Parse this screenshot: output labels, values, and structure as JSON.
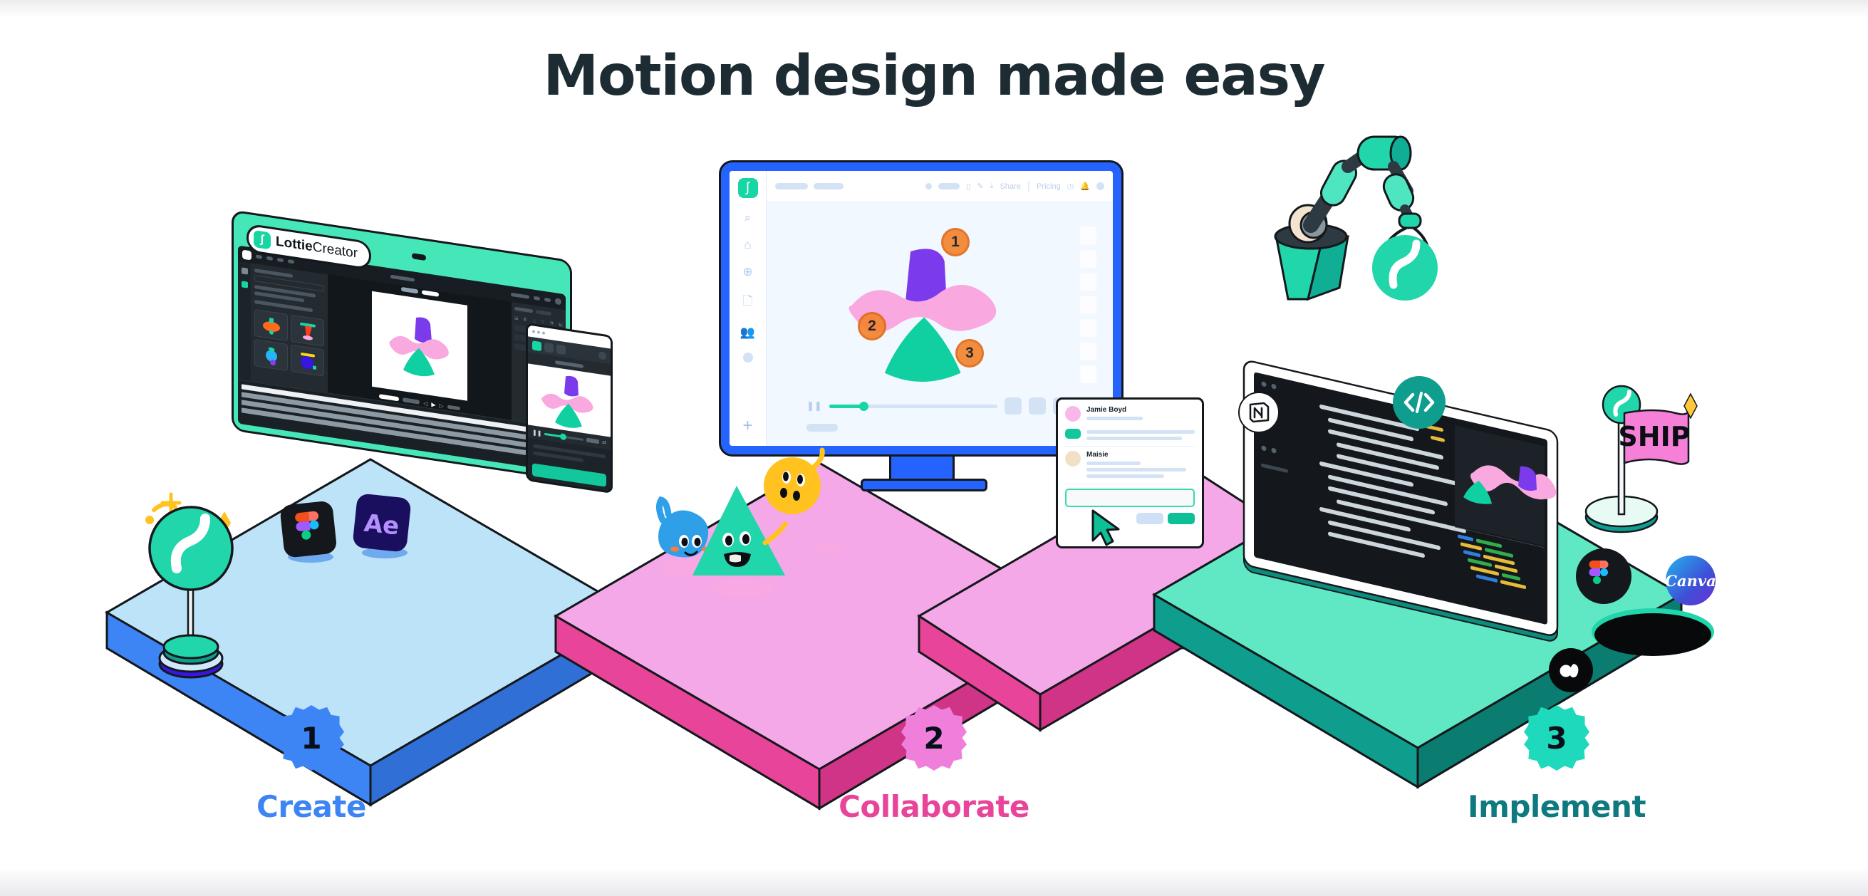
{
  "page": {
    "title": "Motion design made easy",
    "background": "#ffffff"
  },
  "steps": [
    {
      "number": "1",
      "label": "Create",
      "badge_color": "#3d85f5",
      "label_color": "#3d85f5",
      "number_color": "#07101a"
    },
    {
      "number": "2",
      "label": "Collaborate",
      "badge_color": "#f07fdc",
      "label_color": "#e8459a",
      "number_color": "#07101a"
    },
    {
      "number": "3",
      "label": "Implement",
      "badge_color": "#1ed9bc",
      "label_color": "#0e7a80",
      "number_color": "#07101a"
    }
  ],
  "platforms": [
    {
      "name": "create-platform",
      "top_color": "#bde3f8",
      "side_color": "#3d85f5",
      "side_dark": "#2f6fd6"
    },
    {
      "name": "collaborate-platform",
      "top_color": "#f4a8e8",
      "side_color": "#e8459a",
      "side_dark": "#cf3486"
    },
    {
      "name": "implement-platform",
      "top_color": "#5fe8c3",
      "side_color": "#0f9e8e",
      "side_dark": "#0b7c70"
    }
  ],
  "laptop": {
    "name": "lottiecreator-laptop",
    "brand_bold": "Lottie",
    "brand_light": "Creator",
    "shell_color": "#45e6b8",
    "screen_bg": "#1d2429",
    "asset_thumbs": [
      "orange-mushroom",
      "red-swing",
      "blue-balloon",
      "purple-circle"
    ]
  },
  "phone": {
    "name": "mobile-preview",
    "cta_color": "#12c79b"
  },
  "monitor": {
    "name": "lottie-web-app-monitor",
    "bezel_color": "#2563ff",
    "toolbar": {
      "share_label": "Share",
      "pricing_label": "Pricing"
    },
    "sidebar_icons": [
      "search-icon",
      "home-icon",
      "globe-icon",
      "file-icon",
      "people-icon",
      "avatar-icon",
      "plus-icon"
    ],
    "annotations": [
      {
        "number": "1",
        "color": "#f3842f"
      },
      {
        "number": "2",
        "color": "#f3842f"
      },
      {
        "number": "3",
        "color": "#f3842f"
      }
    ],
    "playbar": {
      "progress_percent": 20
    }
  },
  "comment_card": {
    "name": "collaboration-comment-card",
    "comments": [
      {
        "author": "Jamie Boyd",
        "avatar_color": "#f9b8ea"
      },
      {
        "author": "Maisie",
        "avatar_color": "#f1dfc6"
      }
    ],
    "reply_placeholder": "",
    "cancel_label": "",
    "submit_label": ""
  },
  "implement": {
    "robot_arm": {
      "name": "robot-arm",
      "color": "#16d6a4",
      "holds": "lottie-logo-badge"
    },
    "tablet": {
      "name": "code-editor-tablet",
      "screen_bg": "#14181c"
    },
    "flag": {
      "label": "SHIP",
      "flag_color": "#f67fd8",
      "star_color": "#ffc73a"
    },
    "integration_badges": [
      "notion-icon",
      "code-brackets-icon",
      "figma-icon",
      "canva-icon",
      "lottiefiles-icon"
    ]
  },
  "create_badges": [
    "lottie-lollipop-icon",
    "figma-icon",
    "after-effects-icon"
  ],
  "mascots": [
    {
      "name": "blue-blob-mascot",
      "color": "#2f9fe8"
    },
    {
      "name": "green-triangle-mascot",
      "color": "#21d6aa"
    },
    {
      "name": "yellow-balloon-mascot",
      "color": "#ffc21e"
    }
  ],
  "colors": {
    "title": "#1d2b33",
    "teal": "#16d6a4",
    "blue": "#2563ff",
    "pink": "#e8459a",
    "ink": "#14181c"
  }
}
